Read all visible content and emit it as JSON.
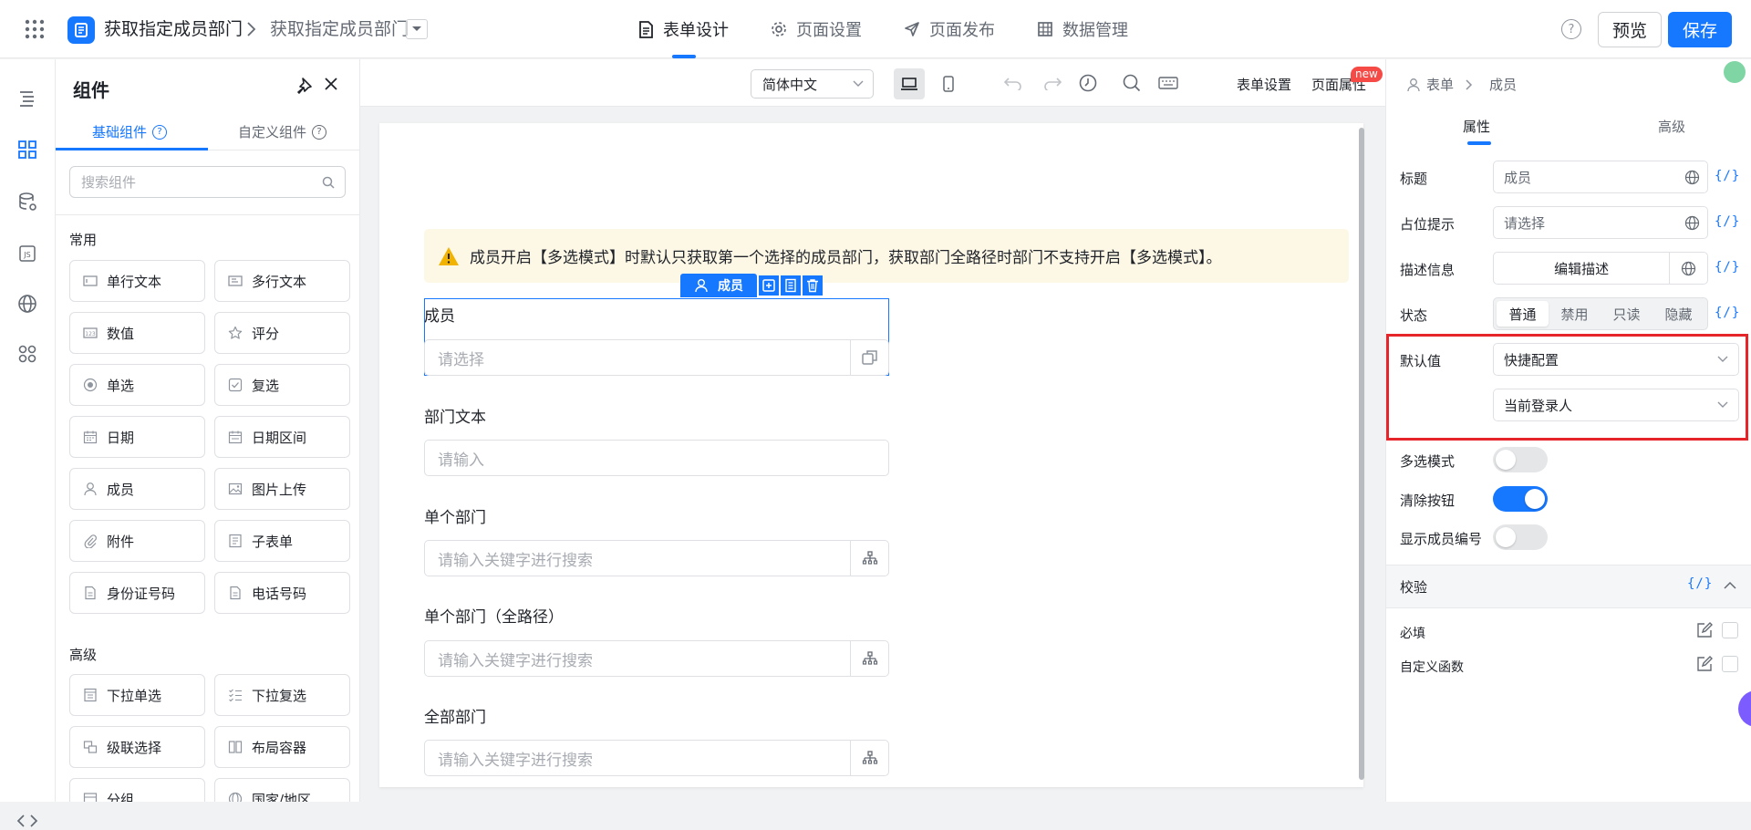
{
  "header": {
    "app_title": "获取指定成员部门",
    "page_title": "获取指定成员部门",
    "tabs": [
      {
        "label": "表单设计",
        "icon": "document-icon",
        "active": true
      },
      {
        "label": "页面设置",
        "icon": "gear-icon",
        "active": false
      },
      {
        "label": "页面发布",
        "icon": "send-icon",
        "active": false
      },
      {
        "label": "数据管理",
        "icon": "table-icon",
        "active": false
      }
    ],
    "help": "?",
    "preview_label": "预览",
    "save_label": "保存",
    "accent": "#1677ff"
  },
  "component_panel": {
    "title": "组件",
    "tabs": [
      {
        "label": "基础组件"
      },
      {
        "label": "自定义组件"
      }
    ],
    "search_placeholder": "搜索组件",
    "groups": [
      {
        "title": "常用",
        "items": [
          {
            "label": "单行文本",
            "icon": "single-line-text-icon"
          },
          {
            "label": "多行文本",
            "icon": "multi-line-text-icon"
          },
          {
            "label": "数值",
            "icon": "number-icon"
          },
          {
            "label": "评分",
            "icon": "star-icon"
          },
          {
            "label": "单选",
            "icon": "radio-icon"
          },
          {
            "label": "复选",
            "icon": "checkbox-icon"
          },
          {
            "label": "日期",
            "icon": "calendar-icon"
          },
          {
            "label": "日期区间",
            "icon": "date-range-icon"
          },
          {
            "label": "成员",
            "icon": "user-icon"
          },
          {
            "label": "图片上传",
            "icon": "image-icon"
          },
          {
            "label": "附件",
            "icon": "paperclip-icon"
          },
          {
            "label": "子表单",
            "icon": "subform-icon"
          },
          {
            "label": "身份证号码",
            "icon": "id-card-icon"
          },
          {
            "label": "电话号码",
            "icon": "phone-icon"
          }
        ]
      },
      {
        "title": "高级",
        "items": [
          {
            "label": "下拉单选",
            "icon": "dropdown-single-icon"
          },
          {
            "label": "下拉复选",
            "icon": "dropdown-multi-icon"
          },
          {
            "label": "级联选择",
            "icon": "cascade-icon"
          },
          {
            "label": "布局容器",
            "icon": "layout-icon"
          },
          {
            "label": "分组",
            "icon": "group-icon"
          },
          {
            "label": "国家/地区",
            "icon": "globe-icon"
          }
        ]
      }
    ]
  },
  "canvas": {
    "language": "简体中文",
    "toolbar_links": [
      "表单设置",
      "页面属性"
    ],
    "new_badge": "new",
    "notice": "成员开启【多选模式】时默认只获取第一个选择的成员部门，获取部门全路径时部门不支持开启【多选模式】。",
    "selected_tag": "成员",
    "fields": [
      {
        "label": "成员",
        "placeholder": "请选择",
        "button_icon": "member-picker-icon"
      },
      {
        "label": "部门文本",
        "placeholder": "请输入",
        "button_icon": ""
      },
      {
        "label": "单个部门",
        "placeholder": "请输入关键字进行搜索",
        "button_icon": "org-tree-icon"
      },
      {
        "label": "单个部门（全路径）",
        "placeholder": "请输入关键字进行搜索",
        "button_icon": "org-tree-icon"
      },
      {
        "label": "全部部门",
        "placeholder": "请输入关键字进行搜索",
        "button_icon": "org-tree-icon"
      }
    ]
  },
  "properties": {
    "breadcrumb": [
      "表单",
      "成员"
    ],
    "tabs": [
      {
        "label": "属性",
        "active": true
      },
      {
        "label": "高级",
        "active": false
      }
    ],
    "fx": "{/}",
    "title_label": "标题",
    "title_value": "成员",
    "placeholder_label": "占位提示",
    "placeholder_value": "请选择",
    "desc_label": "描述信息",
    "desc_button": "编辑描述",
    "state_label": "状态",
    "states": [
      {
        "label": "普通",
        "active": true
      },
      {
        "label": "禁用",
        "active": false
      },
      {
        "label": "只读",
        "active": false
      },
      {
        "label": "隐藏",
        "active": false
      }
    ],
    "default_label": "默认值",
    "default_mode": "快捷配置",
    "default_value": "当前登录人",
    "multi_label": "多选模式",
    "multi_on": false,
    "clear_label": "清除按钮",
    "clear_on": true,
    "show_no_label": "显示成员编号",
    "show_no_on": false,
    "validation_title": "校验",
    "validation_items": [
      {
        "label": "必填",
        "checked": false
      },
      {
        "label": "自定义函数",
        "checked": false
      }
    ],
    "highlight_color": "#e5252a"
  }
}
